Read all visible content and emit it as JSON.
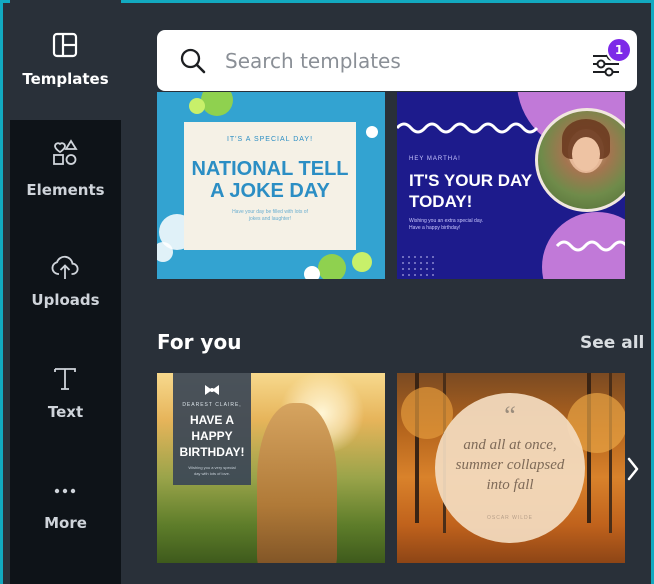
{
  "sidebar": {
    "items": [
      {
        "label": "Templates",
        "icon": "templates-icon"
      },
      {
        "label": "Elements",
        "icon": "elements-icon"
      },
      {
        "label": "Uploads",
        "icon": "upload-cloud-icon"
      },
      {
        "label": "Text",
        "icon": "text-icon"
      },
      {
        "label": "More",
        "icon": "more-dots-icon"
      }
    ]
  },
  "search": {
    "placeholder": "Search templates",
    "filter_badge": "1"
  },
  "templates": {
    "joke": {
      "kicker": "IT'S A SPECIAL DAY!",
      "line1": "NATIONAL TELL",
      "line2": "A JOKE DAY",
      "sub1": "Have your day be filled with lots of",
      "sub2": "jokes and laughter!"
    },
    "birthday_purple": {
      "kicker": "HEY MARTHA!",
      "line1": "IT'S YOUR DAY",
      "line2": "TODAY!",
      "sub1": "Wishing you an extra special day.",
      "sub2": "Have a happy birthday!"
    }
  },
  "for_you": {
    "title": "For you",
    "see_all": "See all",
    "cards": {
      "birthday": {
        "kicker": "DEAREST CLAIRE,",
        "line1": "HAVE A",
        "line2": "HAPPY",
        "line3": "BIRTHDAY!",
        "sub1": "Wishing you a very special",
        "sub2": "day with lots of love."
      },
      "quote": {
        "mark": "“",
        "line1": "and all at once,",
        "line2": "summer collapsed",
        "line3": "into fall",
        "author": "OSCAR WILDE"
      }
    }
  },
  "colors": {
    "accent": "#12a9c0",
    "badge": "#7d2ae8",
    "panel": "#293039",
    "sidebar": "#0e1318"
  }
}
